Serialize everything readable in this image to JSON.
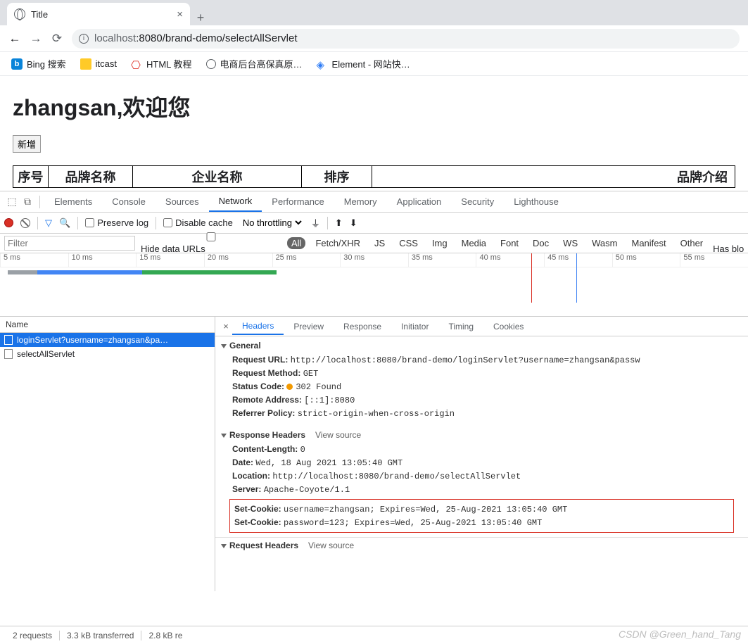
{
  "browser": {
    "tab_title": "Title",
    "url_host": "localhost",
    "url_path": ":8080/brand-demo/selectAllServlet",
    "bookmarks": [
      {
        "label": "Bing 搜索"
      },
      {
        "label": "itcast"
      },
      {
        "label": "HTML 教程"
      },
      {
        "label": "电商后台高保真原…"
      },
      {
        "label": "Element - 网站快…"
      }
    ]
  },
  "page": {
    "heading": "zhangsan,欢迎您",
    "add_button": "新增",
    "cols": [
      "序号",
      "品牌名称",
      "企业名称",
      "排序",
      "品牌介绍"
    ]
  },
  "devtools": {
    "panels": [
      "Elements",
      "Console",
      "Sources",
      "Network",
      "Performance",
      "Memory",
      "Application",
      "Security",
      "Lighthouse"
    ],
    "filter": {
      "preserve_log": "Preserve log",
      "disable_cache": "Disable cache",
      "throttle": "No throttling"
    },
    "types": {
      "filter_ph": "Filter",
      "hide": "Hide data URLs",
      "list": [
        "All",
        "Fetch/XHR",
        "JS",
        "CSS",
        "Img",
        "Media",
        "Font",
        "Doc",
        "WS",
        "Wasm",
        "Manifest",
        "Other"
      ],
      "has_blocked": "Has blo"
    },
    "timeline": [
      "5 ms",
      "10 ms",
      "15 ms",
      "20 ms",
      "25 ms",
      "30 ms",
      "35 ms",
      "40 ms",
      "45 ms",
      "50 ms",
      "55 ms"
    ],
    "requests": {
      "name_col": "Name",
      "rows": [
        {
          "label": "loginServlet?username=zhangsan&pa…",
          "selected": true
        },
        {
          "label": "selectAllServlet",
          "selected": false
        }
      ]
    },
    "detail_tabs": [
      "Headers",
      "Preview",
      "Response",
      "Initiator",
      "Timing",
      "Cookies"
    ],
    "headers": {
      "general_title": "General",
      "general": {
        "request_url_k": "Request URL:",
        "request_url_v": "http://localhost:8080/brand-demo/loginServlet?username=zhangsan&passw",
        "method_k": "Request Method:",
        "method_v": "GET",
        "status_k": "Status Code:",
        "status_v": "302  Found",
        "remote_k": "Remote Address:",
        "remote_v": "[::1]:8080",
        "referrer_k": "Referrer Policy:",
        "referrer_v": "strict-origin-when-cross-origin"
      },
      "response_title": "Response Headers",
      "view_source": "View source",
      "response": {
        "clen_k": "Content-Length:",
        "clen_v": "0",
        "date_k": "Date:",
        "date_v": "Wed, 18 Aug 2021 13:05:40 GMT",
        "loc_k": "Location:",
        "loc_v": "http://localhost:8080/brand-demo/selectAllServlet",
        "server_k": "Server:",
        "server_v": "Apache-Coyote/1.1",
        "sc1_k": "Set-Cookie:",
        "sc1_v": "username=zhangsan; Expires=Wed, 25-Aug-2021 13:05:40 GMT",
        "sc2_k": "Set-Cookie:",
        "sc2_v": "password=123; Expires=Wed, 25-Aug-2021 13:05:40 GMT"
      },
      "request_title": "Request Headers"
    },
    "status": {
      "requests": "2 requests",
      "transferred": "3.3 kB transferred",
      "resources": "2.8 kB re"
    }
  },
  "watermark": "CSDN @Green_hand_Tang"
}
